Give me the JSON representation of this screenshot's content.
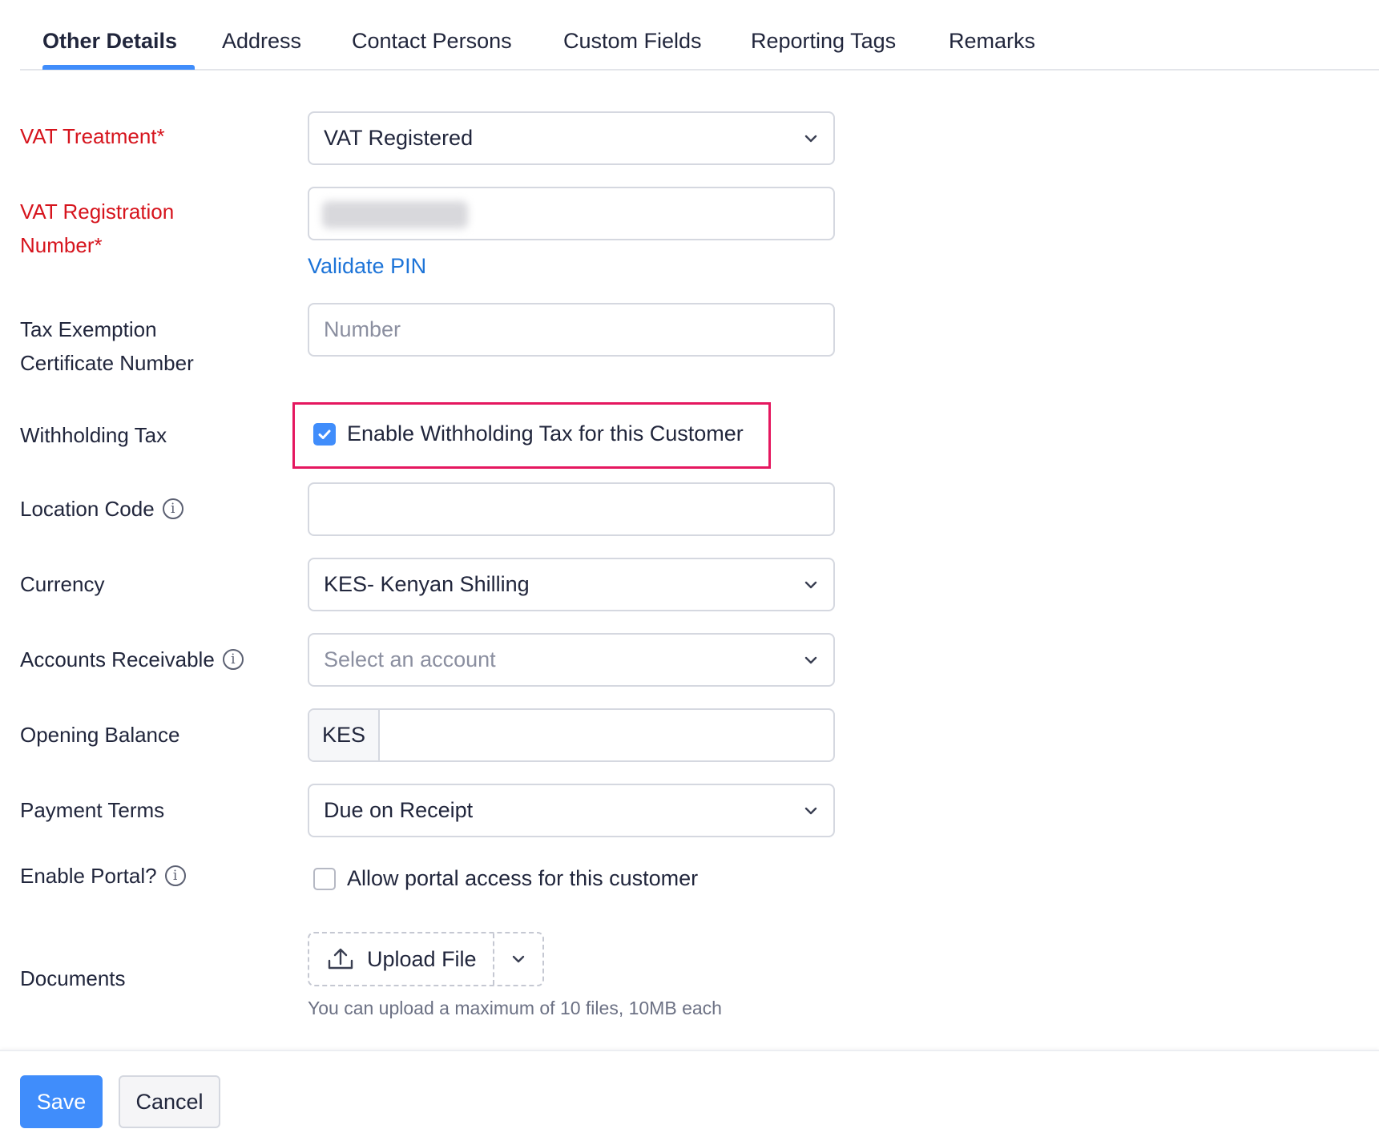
{
  "tabs": [
    {
      "label": "Other Details",
      "active": true
    },
    {
      "label": "Address"
    },
    {
      "label": "Contact Persons"
    },
    {
      "label": "Custom Fields"
    },
    {
      "label": "Reporting Tags"
    },
    {
      "label": "Remarks"
    }
  ],
  "form": {
    "vat_treatment": {
      "label": "VAT Treatment*",
      "value": "VAT Registered"
    },
    "vat_registration": {
      "label_line1": "VAT Registration",
      "label_line2": "Number*",
      "validate_link": "Validate PIN"
    },
    "tax_exemption": {
      "label_line1": "Tax Exemption",
      "label_line2": "Certificate Number",
      "placeholder": "Number"
    },
    "withholding_tax": {
      "label": "Withholding Tax",
      "checkbox_label": "Enable Withholding Tax for this Customer",
      "checked": true
    },
    "location_code": {
      "label": "Location Code",
      "value": ""
    },
    "currency": {
      "label": "Currency",
      "value": "KES- Kenyan Shilling"
    },
    "accounts_receivable": {
      "label": "Accounts Receivable",
      "placeholder": "Select an account"
    },
    "opening_balance": {
      "label": "Opening Balance",
      "prefix": "KES",
      "value": ""
    },
    "payment_terms": {
      "label": "Payment Terms",
      "value": "Due on Receipt"
    },
    "enable_portal": {
      "label": "Enable Portal?",
      "checkbox_label": "Allow portal access for this customer",
      "checked": false
    },
    "documents": {
      "label": "Documents",
      "upload_label": "Upload File",
      "hint": "You can upload a maximum of 10 files, 10MB each"
    }
  },
  "footer": {
    "save_label": "Save",
    "cancel_label": "Cancel"
  },
  "colors": {
    "accent": "#408dfb",
    "required": "#d6141d",
    "link": "#1d74d8",
    "highlight": "#e5175f"
  }
}
